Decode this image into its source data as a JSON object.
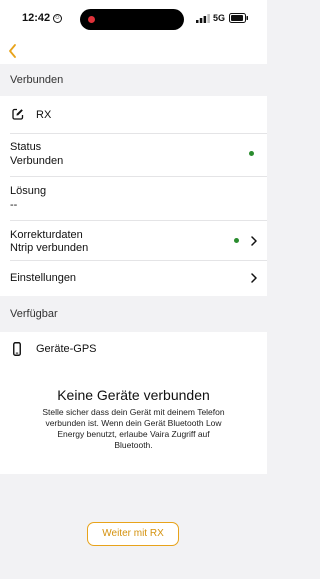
{
  "status_bar": {
    "time": "12:42",
    "network": "5G"
  },
  "sections": {
    "connected": "Verbunden",
    "available": "Verfügbar"
  },
  "device": {
    "name": "RX"
  },
  "rows": {
    "status": {
      "label": "Status",
      "value": "Verbunden"
    },
    "solution": {
      "label": "Lösung",
      "value": "--"
    },
    "corrections": {
      "label": "Korrekturdaten",
      "value": "Ntrip verbunden"
    },
    "settings": {
      "label": "Einstellungen"
    }
  },
  "available_device": {
    "name": "Geräte-GPS"
  },
  "empty_state": {
    "title": "Keine Geräte verbunden",
    "message": "Stelle sicher dass dein Gerät mit deinem Telefon verbunden ist. Wenn dein Gerät Bluetooth Low Energy benutzt, erlaube Vaira Zugriff auf Bluetooth."
  },
  "cta": {
    "label": "Weiter mit RX"
  },
  "colors": {
    "accent": "#e8a31a",
    "status_green": "#2a8c2e"
  }
}
